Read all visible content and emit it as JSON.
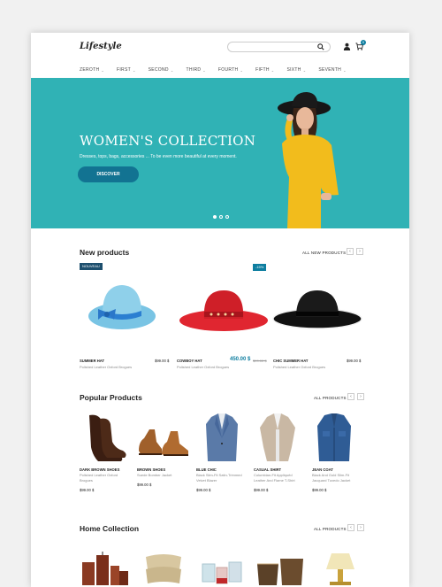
{
  "header": {
    "logo": "Lifestyle",
    "cart_count": "0"
  },
  "nav": [
    "ZEROTH",
    "FIRST",
    "SECOND",
    "THIRD",
    "FOURTH",
    "FIFTH",
    "SIXTH",
    "SEVENTH"
  ],
  "hero": {
    "title": "WOMEN'S COLLECTION",
    "subtitle": "Dresses, tops, bags, accessories ... To be even more beautiful at every moment.",
    "button": "DISCOVER"
  },
  "new_products": {
    "title": "New products",
    "all_link": "ALL NEW PRODUCTS",
    "items": [
      {
        "badge": "NOUVEAU",
        "name": "SUMMER HAT",
        "desc": "Polished Leather Oxford Brogues",
        "price": "$99.00 $"
      },
      {
        "name": "COWBOY HAT",
        "desc": "Polished Leather Oxford Brogues",
        "price": "450.00 $",
        "old_price": "$99.00 $"
      },
      {
        "badge": "-15%",
        "name": "CHIC SUMMER HAT",
        "desc": "Polished Leather Oxford Brogues",
        "price": "$99.00 $"
      }
    ]
  },
  "popular_products": {
    "title": "Popular Products",
    "all_link": "ALL PRODUCTS",
    "items": [
      {
        "name": "DARK BROWN SHOES",
        "desc": "Polished Leather Oxford Brogues",
        "price": "$99.00 $"
      },
      {
        "name": "BROWN SHOES",
        "desc": "Suede Bomber Jacket",
        "price": "$99.00 $"
      },
      {
        "name": "BLUE CHIC",
        "desc": "Black Slim-Fit Satin-Trimmed Velvet Blazer",
        "price": "$99.00 $"
      },
      {
        "name": "CASUAL SHIRT",
        "desc": "Columbian-Fit Appliquéd Leather And Flame T-Shirt",
        "price": "$99.00 $"
      },
      {
        "name": "JEAN COAT",
        "desc": "Black And Gold Slim-Fit Jacquard Tuxedo Jacket",
        "price": "$99.00 $"
      }
    ]
  },
  "home_collection": {
    "title": "Home Collection",
    "all_link": "ALL PRODUCTS"
  },
  "colors": {
    "accent": "#0e7ea0",
    "hero_bg": "#30b2b5",
    "button": "#127392"
  }
}
